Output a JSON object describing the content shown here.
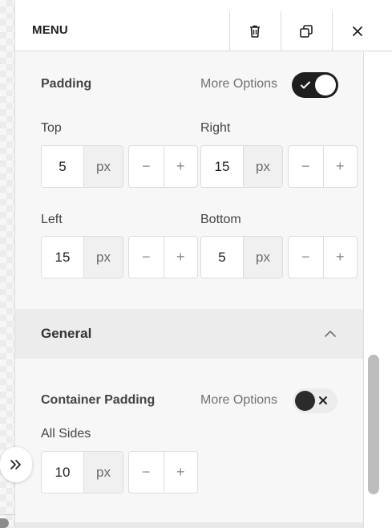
{
  "header": {
    "title": "MENU",
    "icons": {
      "delete": "trash-icon",
      "duplicate": "duplicate-icon",
      "close": "close-icon"
    }
  },
  "padding": {
    "label": "Padding",
    "more_options_label": "More Options",
    "more_options_enabled": true,
    "top": {
      "label": "Top",
      "value": "5",
      "unit": "px"
    },
    "right": {
      "label": "Right",
      "value": "15",
      "unit": "px"
    },
    "left": {
      "label": "Left",
      "value": "15",
      "unit": "px"
    },
    "bottom": {
      "label": "Bottom",
      "value": "5",
      "unit": "px"
    }
  },
  "stepper": {
    "minus": "−",
    "plus": "+"
  },
  "general": {
    "title": "General",
    "expanded": true,
    "container_padding": {
      "label": "Container Padding",
      "more_options_label": "More Options",
      "more_options_enabled": false,
      "all_sides": {
        "label": "All Sides",
        "value": "10",
        "unit": "px"
      }
    }
  },
  "colors": {
    "toggle_on": "#1e1e1e",
    "panel_bg": "#f7f7f7",
    "section_header_bg": "#ececec"
  }
}
